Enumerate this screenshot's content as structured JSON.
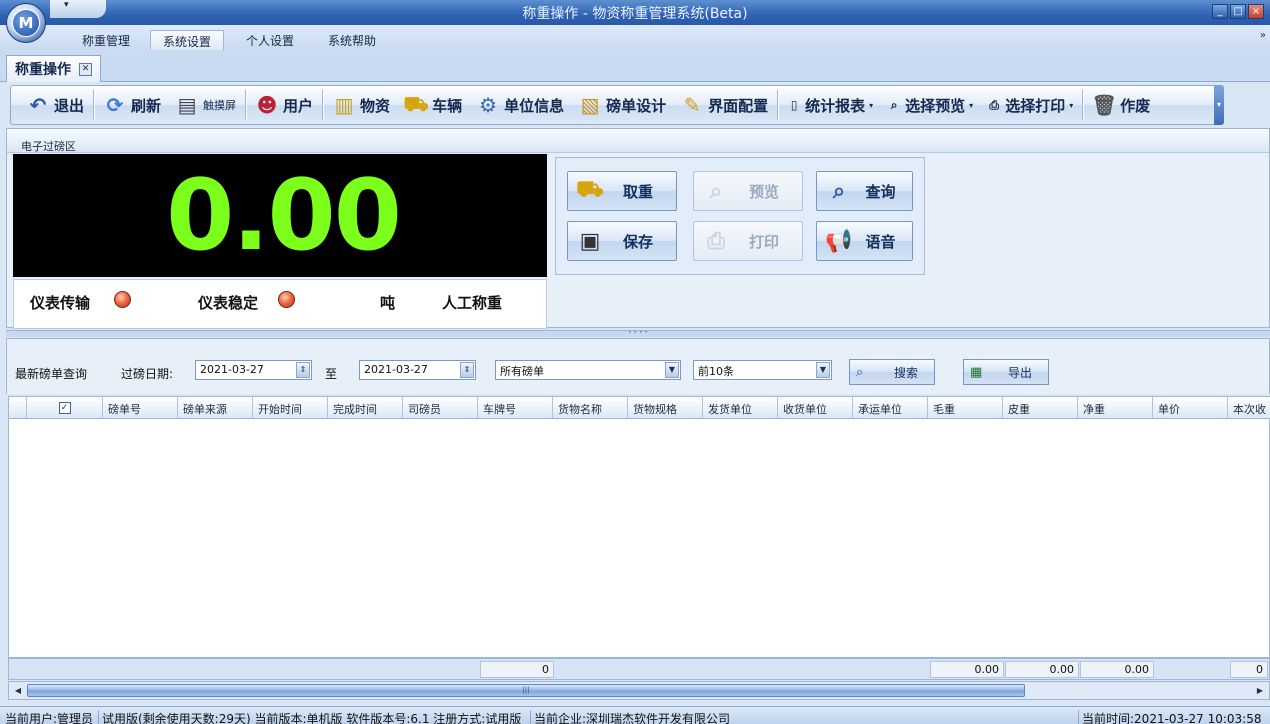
{
  "window": {
    "title": "称重操作 - 物资称重管理系统(Beta)",
    "orb_letter": "M",
    "qat_arrow": "▾"
  },
  "menu": {
    "items": [
      "称重管理",
      "系统设置",
      "个人设置",
      "系统帮助"
    ],
    "active": "系统设置"
  },
  "doc_tab": {
    "label": "称重操作"
  },
  "toolbar": {
    "items": [
      {
        "label": "退出",
        "icon": "exit-icon"
      },
      {
        "label": "刷新",
        "icon": "refresh-icon"
      },
      {
        "label": "触摸屏",
        "icon": "touchscreen-icon"
      },
      {
        "label": "用户",
        "icon": "user-icon"
      },
      {
        "label": "物资",
        "icon": "materials-icon"
      },
      {
        "label": "车辆",
        "icon": "vehicle-icon"
      },
      {
        "label": "单位信息",
        "icon": "unit-info-icon"
      },
      {
        "label": "磅单设计",
        "icon": "ticket-design-icon"
      },
      {
        "label": "界面配置",
        "icon": "ui-config-icon"
      },
      {
        "label": "统计报表",
        "icon": "report-icon"
      },
      {
        "label": "选择预览",
        "icon": "preview-icon"
      },
      {
        "label": "选择打印",
        "icon": "print-icon"
      },
      {
        "label": "作废",
        "icon": "trash-icon"
      }
    ]
  },
  "area": {
    "label": "电子过磅区"
  },
  "scale": {
    "value": "0.00"
  },
  "status": {
    "transmit": "仪表传输",
    "stable": "仪表稳定",
    "unit": "吨",
    "mode": "人工称重",
    "led_color": "#f06a45"
  },
  "actions": {
    "fetch": "取重",
    "preview": "预览",
    "query": "查询",
    "save": "保存",
    "print": "打印",
    "voice": "语音"
  },
  "query": {
    "title": "最新磅单查询",
    "date_label": "过磅日期:",
    "date_from": "2021-03-27",
    "to": "至",
    "date_to": "2021-03-27",
    "ticket_type": "所有磅单",
    "limit": "前10条",
    "search": "搜索",
    "export": "导出"
  },
  "table": {
    "columns": [
      "磅单号",
      "磅单来源",
      "开始时间",
      "完成时间",
      "司磅员",
      "车牌号",
      "货物名称",
      "货物规格",
      "发货单位",
      "收货单位",
      "承运单位",
      "毛重",
      "皮重",
      "净重",
      "单价",
      "本次收"
    ],
    "check_mark": "✓"
  },
  "totals": {
    "count": "0",
    "gross": "0.00",
    "tare": "0.00",
    "net": "0.00",
    "last": "0"
  },
  "statusbar": {
    "user": "当前用户:管理员",
    "version": "试用版(剩余使用天数:29天) 当前版本:单机版 软件版本号:6.1 注册方式:试用版",
    "company": "当前企业:深圳瑞杰软件开发有限公司",
    "time": "当前时间:2021-03-27 10:03:58"
  }
}
